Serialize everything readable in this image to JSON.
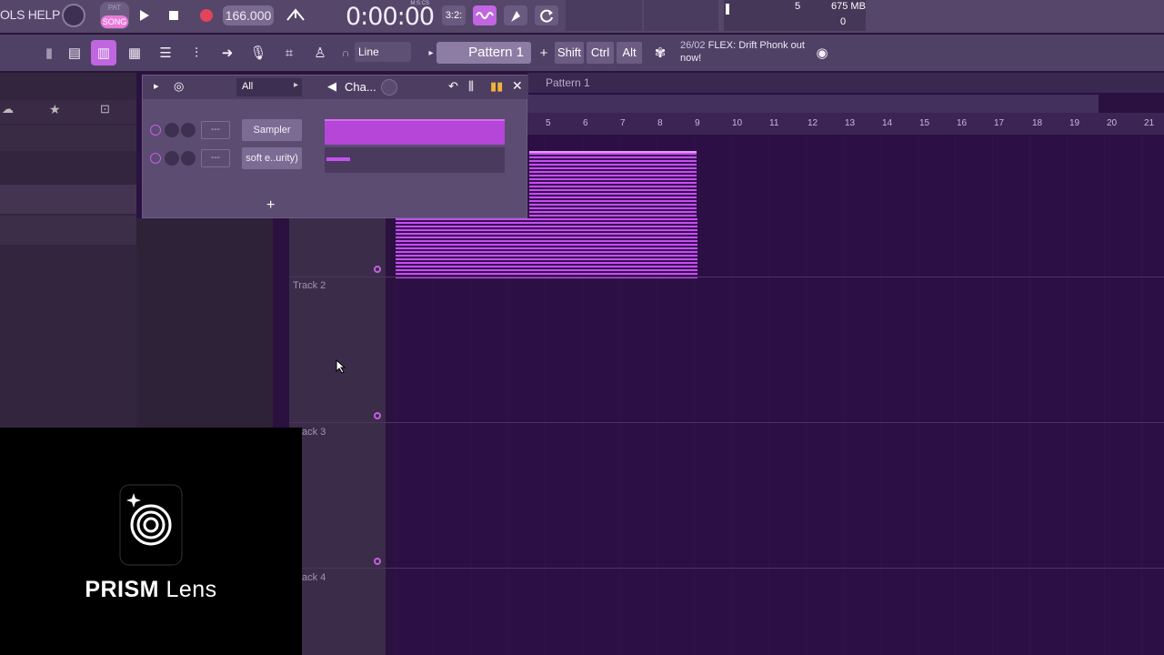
{
  "menu": {
    "text": "OLS HELP"
  },
  "transport": {
    "pat_label": "PAT",
    "song_label": "SONG",
    "tempo": "166.000",
    "time_label": "M:S:CS",
    "time": "0:00:00",
    "snap_fraction": "3:2:"
  },
  "monitor": {
    "cpu": "5",
    "memory": "675 MB",
    "polyphony": "0"
  },
  "toolbar2": {
    "snap_mode": "Line",
    "pattern": "Pattern 1",
    "pattern_add": "+",
    "keys": [
      "Shift",
      "Ctrl",
      "Alt"
    ],
    "news_date": "26/02",
    "news_text": "FLEX: Drift Phonk out now!"
  },
  "channel_rack": {
    "filter": "All",
    "title": "Cha...",
    "channels": [
      {
        "name": "Sampler",
        "dash": "---"
      },
      {
        "name": "soft e..urity)",
        "dash": "---"
      }
    ],
    "add": "+"
  },
  "playlist": {
    "pattern_title": "Pattern 1",
    "ruler_ticks": [
      "5",
      "6",
      "7",
      "8",
      "9",
      "10",
      "11",
      "12",
      "13",
      "14",
      "15",
      "16",
      "17",
      "18",
      "19",
      "20",
      "21"
    ],
    "tracks": [
      "Track 2",
      "ack 3",
      "ack 4"
    ]
  },
  "overlay": {
    "brand_bold": "PRISM",
    "brand_light": "Lens"
  },
  "colors": {
    "accent": "#c64ff0",
    "background": "#2c0f44",
    "toolbar": "#55466a"
  }
}
